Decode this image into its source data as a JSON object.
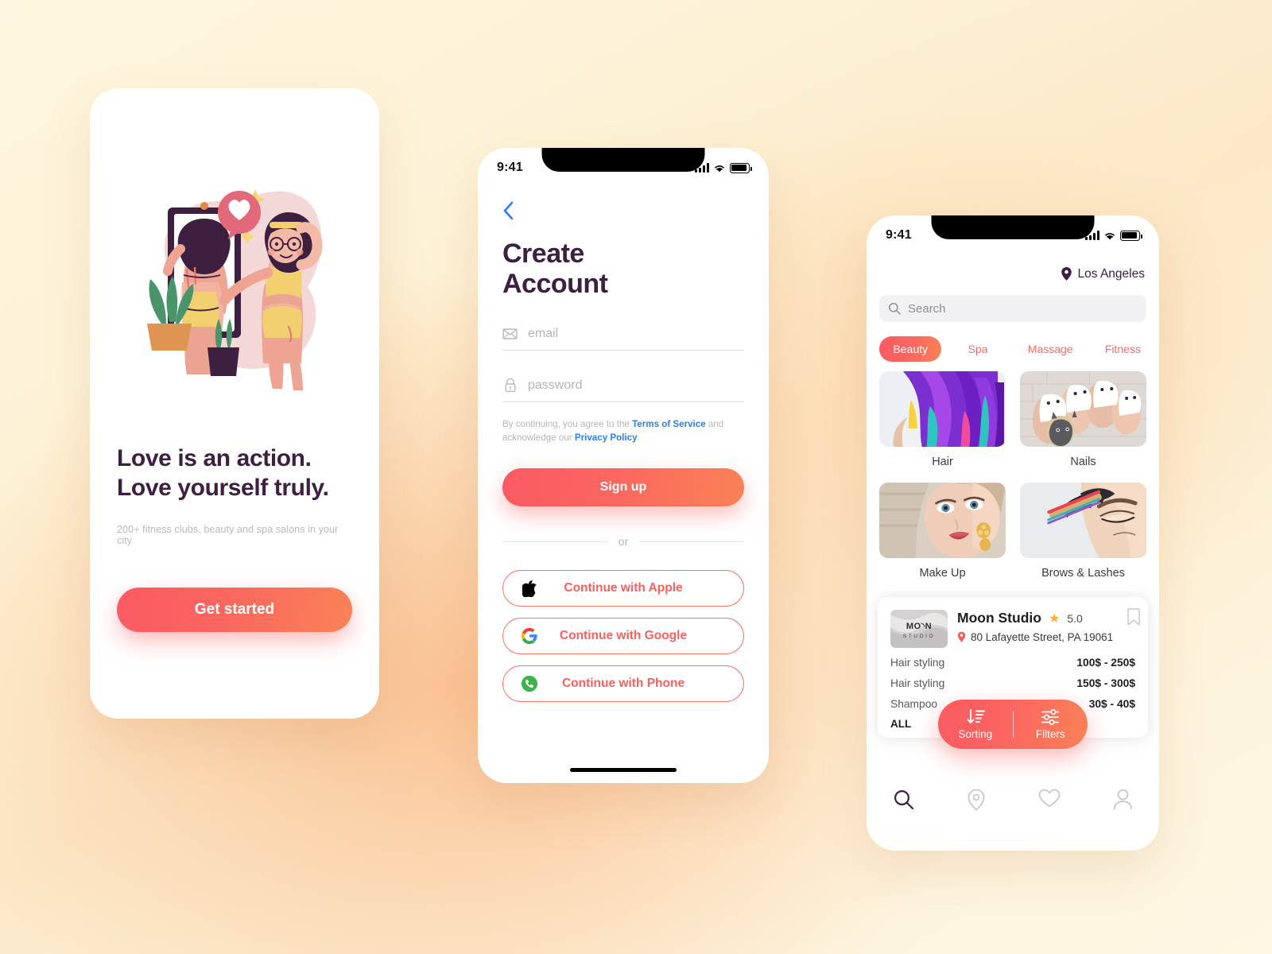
{
  "background": {
    "gradient_from": "#fdf6de",
    "gradient_mid": "#fbd9ae",
    "gradient_to": "#fdf7e3"
  },
  "accent": {
    "primary": "#fb5a62",
    "secondary": "#fa8256",
    "link": "#2f7df6",
    "dark_text": "#3d2040",
    "star": "#fbb034"
  },
  "screen_onboarding": {
    "name": "Onboarding",
    "illustration_alt": "woman-in-mirror-illustration",
    "title_line1": "Love is an action.",
    "title_line2": "Love yourself truly.",
    "subtitle": "200+ fitness clubs, beauty and spa salons in your city",
    "cta_label": "Get started"
  },
  "screen_signup": {
    "name": "Create Account",
    "statusbar": {
      "time": "9:41"
    },
    "back_label": "Back",
    "title_line1": "Create",
    "title_line2": "Account",
    "fields": [
      {
        "name": "email",
        "icon": "envelope-icon",
        "placeholder": "email",
        "value": ""
      },
      {
        "name": "password",
        "icon": "lock-icon",
        "placeholder": "password",
        "value": ""
      }
    ],
    "legal": {
      "part1": "By continuing, you agree to the ",
      "terms": "Terms of Service",
      "part2": " and acknowledge our ",
      "privacy": "Privacy Policy",
      "part3": "."
    },
    "signup_label": "Sign up",
    "divider_label": "or",
    "social": [
      {
        "icon": "apple-icon",
        "label": "Continue with Apple"
      },
      {
        "icon": "google-icon",
        "label": "Continue with Google"
      },
      {
        "icon": "phone-icon",
        "label": "Continue with Phone"
      }
    ]
  },
  "screen_browse": {
    "name": "Browse",
    "statusbar": {
      "time": "9:41"
    },
    "location": "Los Angeles",
    "search_placeholder": "Search",
    "search_value": "",
    "tabs": [
      {
        "label": "Beauty",
        "active": true
      },
      {
        "label": "Spa",
        "active": false
      },
      {
        "label": "Massage",
        "active": false
      },
      {
        "label": "Fitness",
        "active": false
      }
    ],
    "categories": [
      {
        "label": "Hair",
        "image": "rainbow-purple-hair-photo"
      },
      {
        "label": "Nails",
        "image": "nail-art-photo"
      },
      {
        "label": "Make Up",
        "image": "makeup-model-photo"
      },
      {
        "label": "Brows & Lashes",
        "image": "brow-treatment-photo"
      }
    ],
    "salon": {
      "logo_line1": "MOON",
      "logo_line2": "STUDIO",
      "name": "Moon Studio",
      "rating": "5.0",
      "address": "80 Lafayette Street, PA 19061",
      "bookmark_icon": "bookmark-icon",
      "services": [
        {
          "name": "Hair styling",
          "price": "100$ - 250$"
        },
        {
          "name": "Hair styling",
          "price": "150$ - 300$"
        },
        {
          "name": "Shampoo",
          "price": "30$ - 40$"
        }
      ],
      "all_label": "ALL"
    },
    "floating": {
      "sorting_label": "Sorting",
      "sorting_icon": "sort-descending-icon",
      "filters_label": "Filters",
      "filters_icon": "sliders-icon"
    },
    "tabbar": [
      {
        "icon": "search-icon",
        "active": true
      },
      {
        "icon": "location-pin-icon",
        "active": false
      },
      {
        "icon": "heart-icon",
        "active": false
      },
      {
        "icon": "person-icon",
        "active": false
      }
    ]
  }
}
